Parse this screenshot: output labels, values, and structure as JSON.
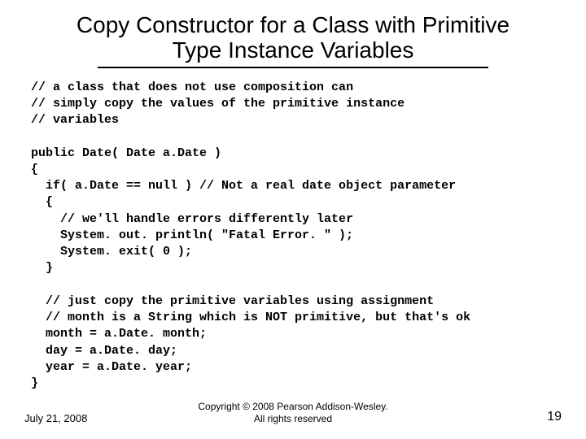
{
  "title_line1": "Copy Constructor for a Class with Primitive",
  "title_line2": "Type Instance Variables",
  "code_lines": [
    "// a class that does not use composition can",
    "// simply copy the values of the primitive instance",
    "// variables",
    "",
    "public Date( Date a.Date )",
    "{",
    "  if( a.Date == null ) // Not a real date object parameter",
    "  {",
    "    // we'll handle errors differently later",
    "    System. out. println( \"Fatal Error. \" );",
    "    System. exit( 0 );",
    "  }",
    "",
    "  // just copy the primitive variables using assignment",
    "  // month is a String which is NOT primitive, but that's ok",
    "  month = a.Date. month;",
    "  day = a.Date. day;",
    "  year = a.Date. year;",
    "}"
  ],
  "footer": {
    "date": "July 21, 2008",
    "copyright_line1": "Copyright © 2008 Pearson Addison-Wesley.",
    "copyright_line2": "All rights reserved",
    "page": "19"
  }
}
